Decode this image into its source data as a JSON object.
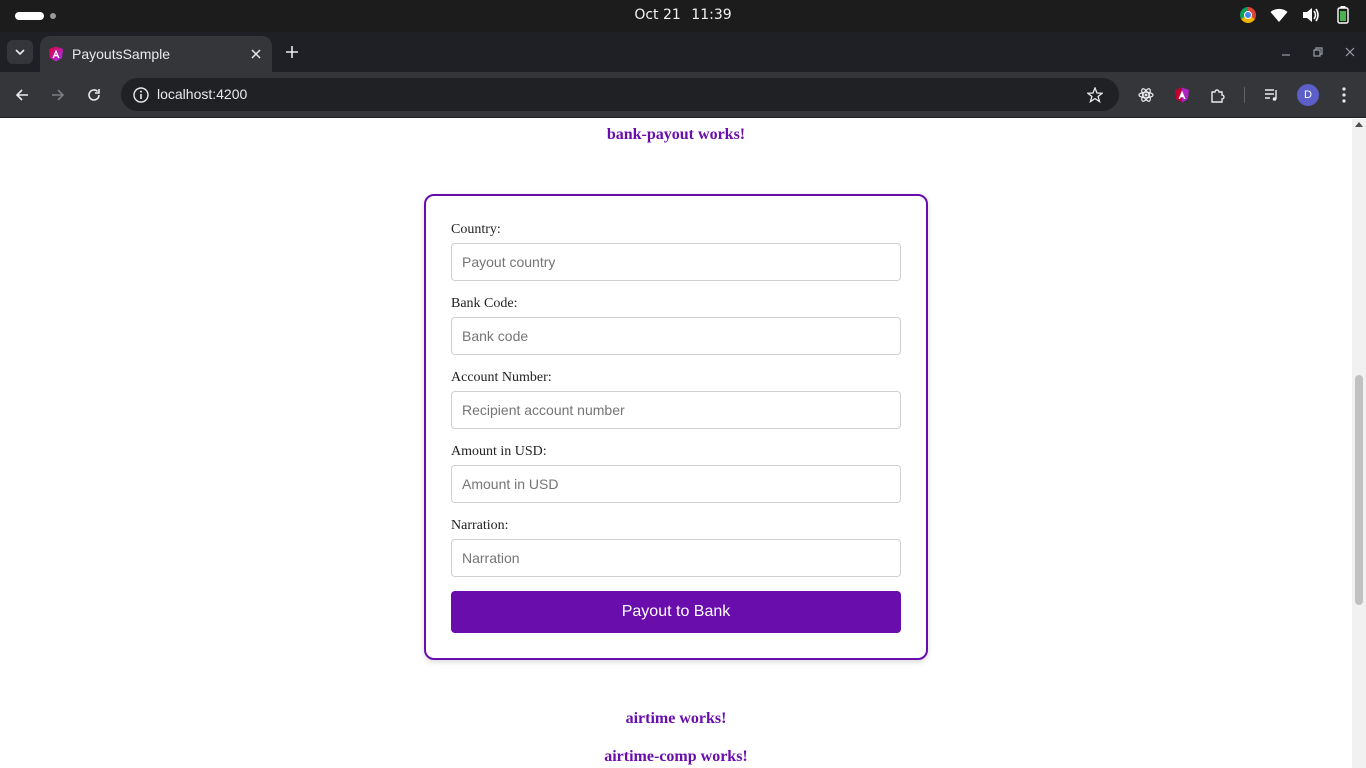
{
  "os": {
    "date": "Oct 21",
    "time": "11:39",
    "tray_icons": [
      "chrome-icon",
      "wifi-icon",
      "volume-icon",
      "battery-icon"
    ]
  },
  "browser": {
    "tab_title": "PayoutsSample",
    "url": "localhost:4200",
    "avatar_letter": "D",
    "colors": {
      "tab_strip": "#1f2025",
      "toolbar": "#35363a",
      "omnibox": "#202124"
    }
  },
  "page": {
    "accent_color": "#6a0dad",
    "header_text": "bank-payout works!",
    "form": {
      "fields": [
        {
          "label": "Country:",
          "placeholder": "Payout country",
          "value": ""
        },
        {
          "label": "Bank Code:",
          "placeholder": "Bank code",
          "value": ""
        },
        {
          "label": "Account Number:",
          "placeholder": "Recipient account number",
          "value": ""
        },
        {
          "label": "Amount in USD:",
          "placeholder": "Amount in USD",
          "value": ""
        },
        {
          "label": "Narration:",
          "placeholder": "Narration",
          "value": ""
        }
      ],
      "submit_label": "Payout to Bank"
    },
    "footer_lines": [
      "airtime works!",
      "airtime-comp works!"
    ]
  }
}
